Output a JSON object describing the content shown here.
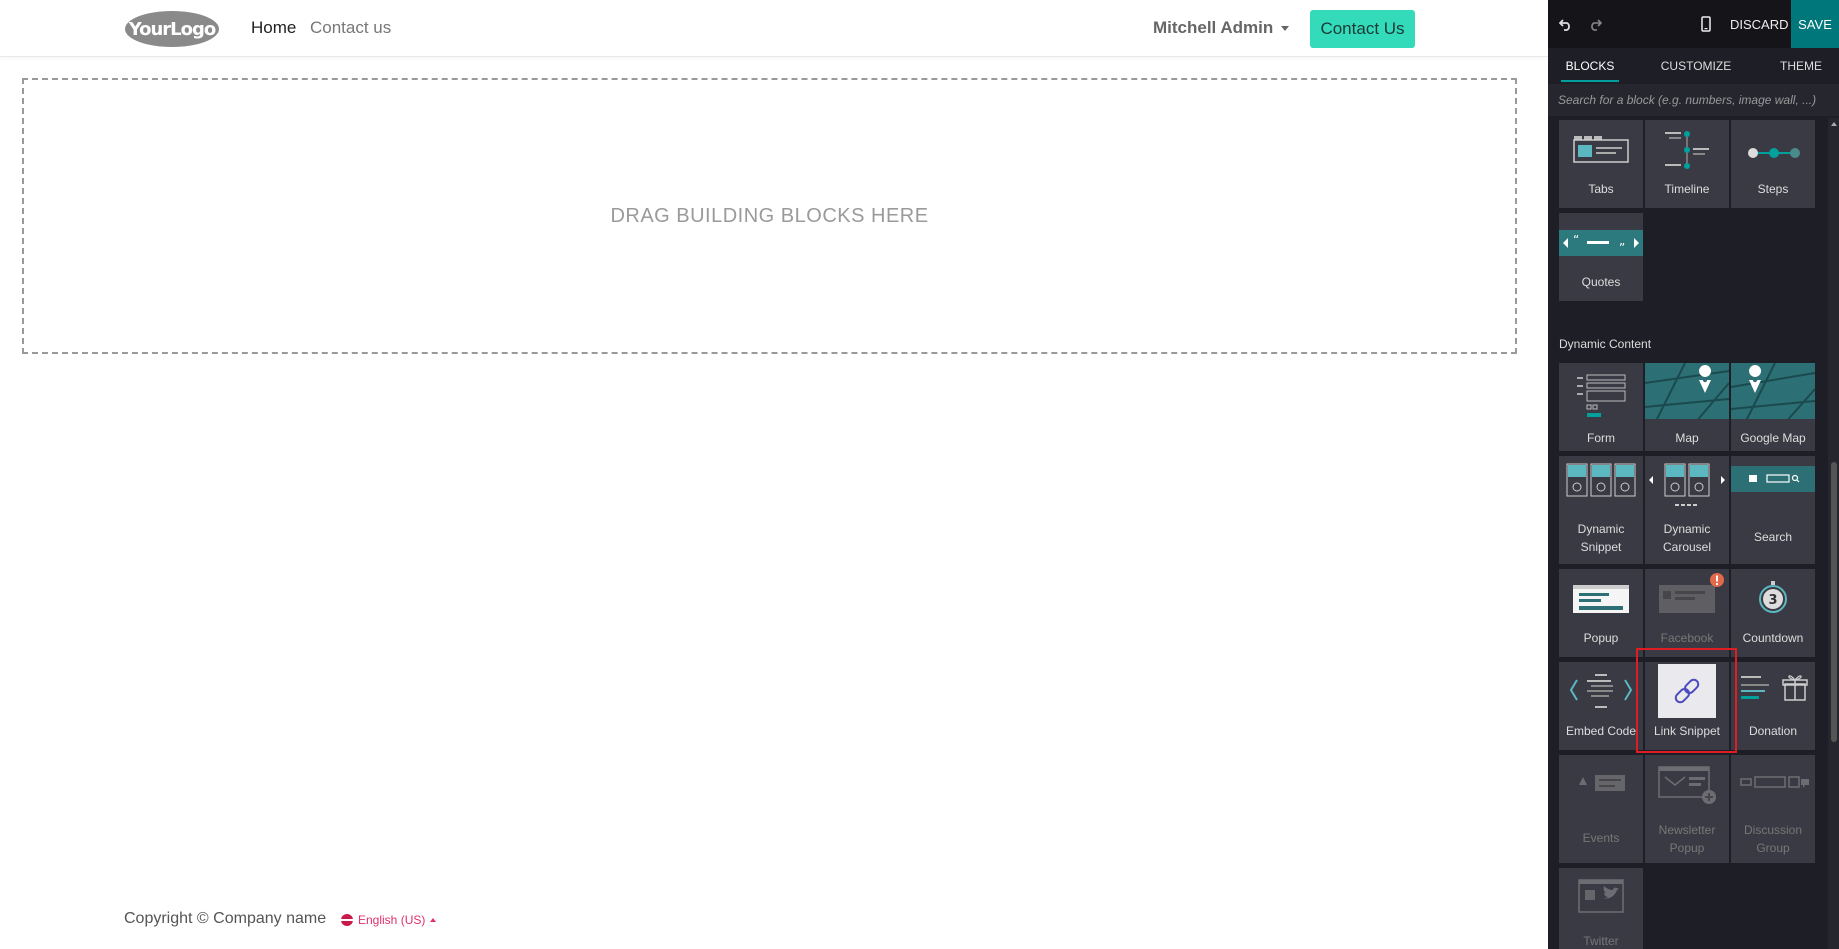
{
  "site": {
    "logo": {
      "text": "YourLogo",
      "color": "#8a8a8a"
    },
    "nav": {
      "home": "Home",
      "contact": "Contact us"
    },
    "user": "Mitchell Admin",
    "cta": {
      "label": "Contact Us",
      "color": "#34dbbb"
    },
    "dropzone": "DRAG BUILDING BLOCKS HERE",
    "footer": {
      "copyright": "Copyright © Company name",
      "language": "English (US)"
    }
  },
  "editor": {
    "toolbar": {
      "undo_icon": "undo-icon",
      "redo_icon": "redo-icon",
      "mobile_icon": "mobile-icon",
      "discard": "DISCARD",
      "save": "SAVE",
      "save_color": "#00777a"
    },
    "tabs": {
      "blocks": "BLOCKS",
      "customize": "CUSTOMIZE",
      "theme": "THEME"
    },
    "search": {
      "placeholder": "Search for a block (e.g. numbers, image wall, ...)"
    },
    "sections": {
      "dynamic": "Dynamic Content"
    },
    "blocks": {
      "tabs": "Tabs",
      "timeline": "Timeline",
      "steps": "Steps",
      "quotes": "Quotes",
      "form": "Form",
      "map": "Map",
      "google_map": "Google Map",
      "dynamic_snippet_1": "Dynamic",
      "dynamic_snippet_2": "Snippet",
      "dynamic_carousel_1": "Dynamic",
      "dynamic_carousel_2": "Carousel",
      "search": "Search",
      "popup": "Popup",
      "facebook": "Facebook",
      "countdown": "Countdown",
      "countdown_number": "3",
      "embed_code": "Embed Code",
      "link_snippet": "Link Snippet",
      "donation": "Donation",
      "events": "Events",
      "newsletter_popup_1": "Newsletter",
      "newsletter_popup_2": "Popup",
      "discussion_group_1": "Discussion",
      "discussion_group_2": "Group",
      "twitter": "Twitter"
    },
    "accent": "#00a09d",
    "highlight_color": "#e11d24"
  }
}
